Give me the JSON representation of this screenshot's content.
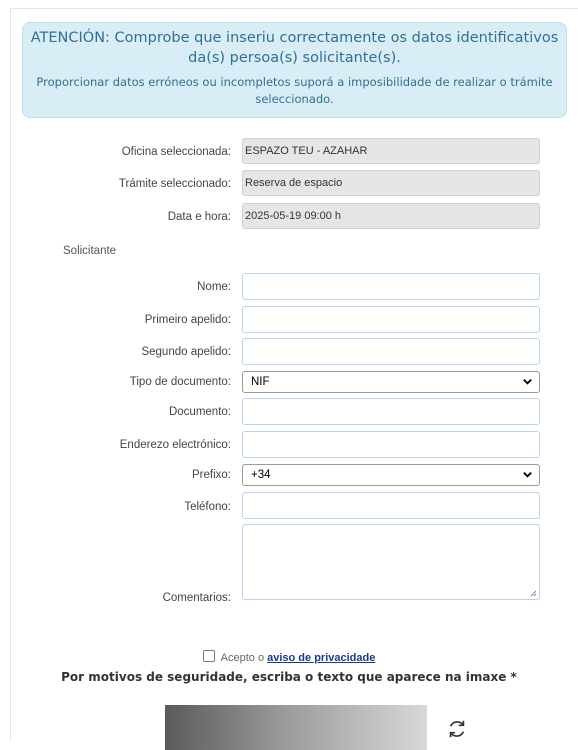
{
  "alert": {
    "title": "ATENCIÓN: Comprobe que inseriu correctamente os datos identificativos da(s) persoa(s) solicitante(s).",
    "subtitle": "Proporcionar datos erróneos ou incompletos suporá a imposibilidade de realizar o trámite seleccionado."
  },
  "summary": {
    "office_label": "Oficina seleccionada:",
    "office_value": "ESPAZO TEU - AZAHAR",
    "procedure_label": "Trámite seleccionado:",
    "procedure_value": "Reserva de espacio",
    "datetime_label": "Data e hora:",
    "datetime_value": "2025-05-19 09:00 h"
  },
  "section_title": "Solicitante",
  "form": {
    "name_label": "Nome:",
    "surname1_label": "Primeiro apelido:",
    "surname2_label": "Segundo apelido:",
    "doc_type_label": "Tipo de documento:",
    "doc_type_value": "NIF",
    "document_label": "Documento:",
    "email_label": "Enderezo electrónico:",
    "prefix_label": "Prefixo:",
    "prefix_value": "+34",
    "phone_label": "Teléfono:",
    "comments_label": "Comentarios:"
  },
  "privacy": {
    "accept_text": "Acepto o",
    "link_text": "aviso de privacidade"
  },
  "security_text": "Por motivos de seguridade, escriba o texto que aparece na imaxe *"
}
